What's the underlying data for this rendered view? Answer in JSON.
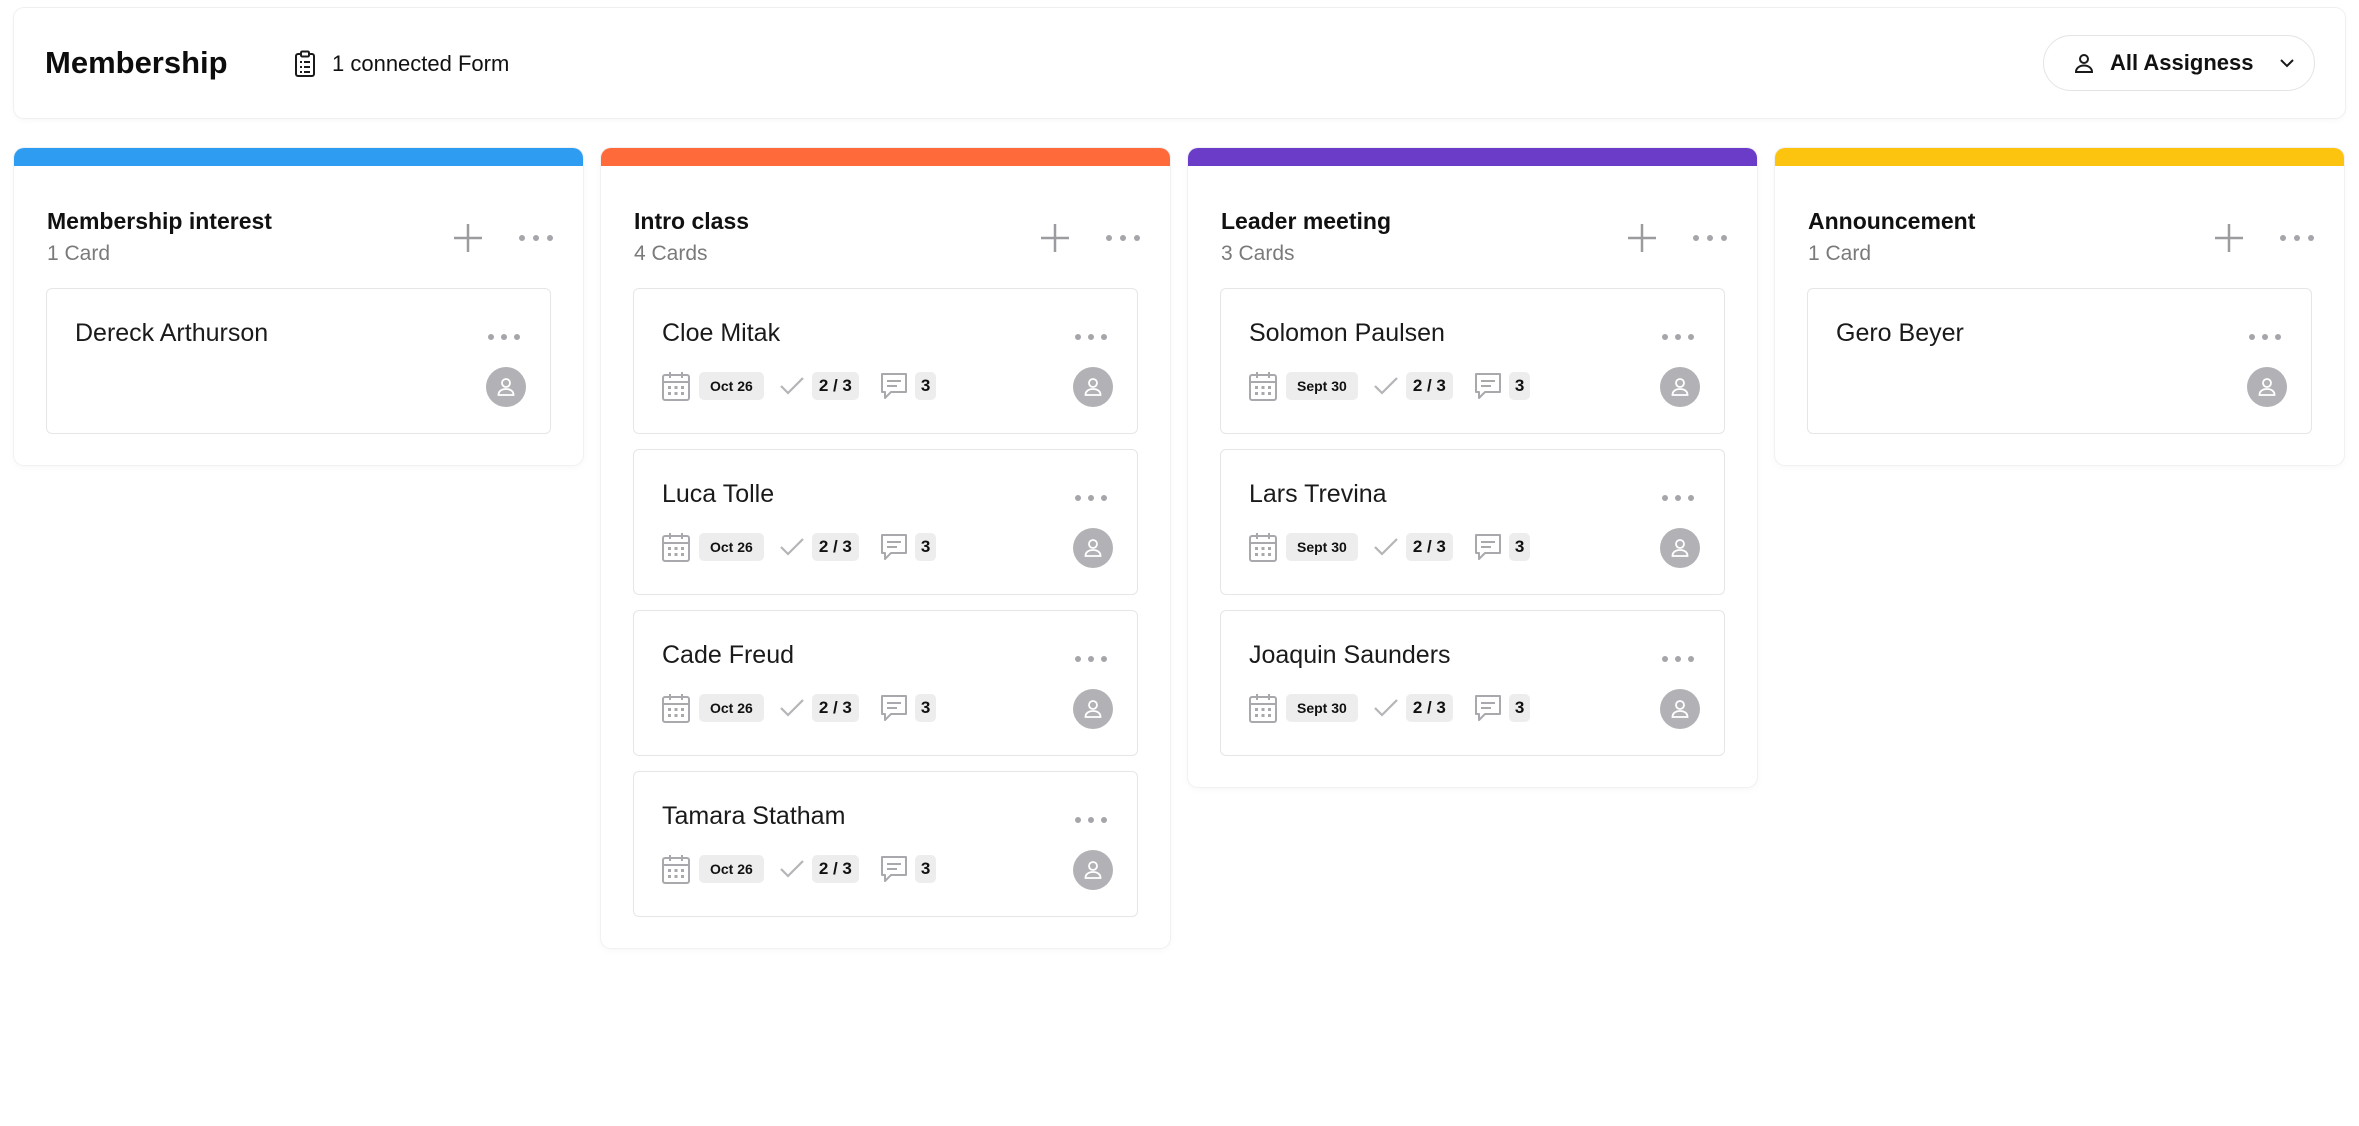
{
  "header": {
    "title": "Membership",
    "connected_forms": "1 connected Form",
    "assignee_filter": "All Assigness"
  },
  "icons": {
    "form": "clipboard-icon",
    "user": "person-icon",
    "chevron": "chevron-down-icon",
    "add": "plus-icon",
    "more": "ellipsis-icon",
    "date": "calendar-icon",
    "tasks": "check-icon",
    "comments": "comment-icon",
    "avatar": "avatar-icon"
  },
  "columns": [
    {
      "title": "Membership interest",
      "count": "1 Card",
      "color": "#2e9df1",
      "cards": [
        {
          "name": "Dereck Arthurson"
        }
      ]
    },
    {
      "title": "Intro class",
      "count": "4 Cards",
      "color": "#ff6a3b",
      "cards": [
        {
          "name": "Cloe Mitak",
          "date": "Oct 26",
          "tasks": "2 / 3",
          "comments": "3"
        },
        {
          "name": "Luca Tolle",
          "date": "Oct 26",
          "tasks": "2 / 3",
          "comments": "3"
        },
        {
          "name": "Cade Freud",
          "date": "Oct 26",
          "tasks": "2 / 3",
          "comments": "3"
        },
        {
          "name": "Tamara Statham",
          "date": "Oct 26",
          "tasks": "2 / 3",
          "comments": "3"
        }
      ]
    },
    {
      "title": "Leader meeting",
      "count": "3 Cards",
      "color": "#6a3cc8",
      "cards": [
        {
          "name": "Solomon Paulsen",
          "date": "Sept 30",
          "tasks": "2 / 3",
          "comments": "3"
        },
        {
          "name": "Lars Trevina",
          "date": "Sept 30",
          "tasks": "2 / 3",
          "comments": "3"
        },
        {
          "name": "Joaquin Saunders",
          "date": "Sept 30",
          "tasks": "2 / 3",
          "comments": "3"
        }
      ]
    },
    {
      "title": "Announcement",
      "count": "1 Card",
      "color": "#fcc30f",
      "cards": [
        {
          "name": "Gero Beyer"
        }
      ]
    }
  ]
}
